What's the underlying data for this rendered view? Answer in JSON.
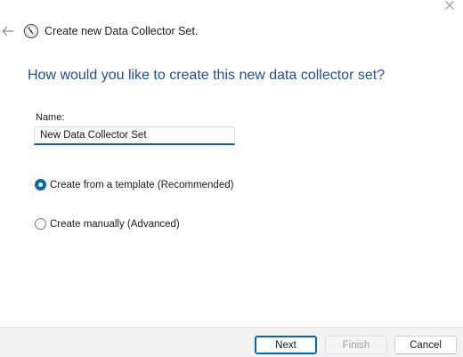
{
  "window": {
    "title": "Create new Data Collector Set.",
    "close_icon": "close-icon",
    "back_icon": "back-arrow-icon",
    "app_icon": "performance-monitor-icon"
  },
  "main": {
    "heading": "How would you like to create this new data collector set?",
    "name_label": "Name:",
    "name_value": "New Data Collector Set",
    "options": [
      {
        "label": "Create from a template (Recommended)",
        "selected": true
      },
      {
        "label": "Create manually (Advanced)",
        "selected": false
      }
    ]
  },
  "footer": {
    "next_label": "Next",
    "finish_label": "Finish",
    "finish_enabled": false,
    "cancel_label": "Cancel"
  },
  "colors": {
    "accent": "#0067c0",
    "heading": "#1f4e9c",
    "footer_bg": "#f3f3f3"
  }
}
